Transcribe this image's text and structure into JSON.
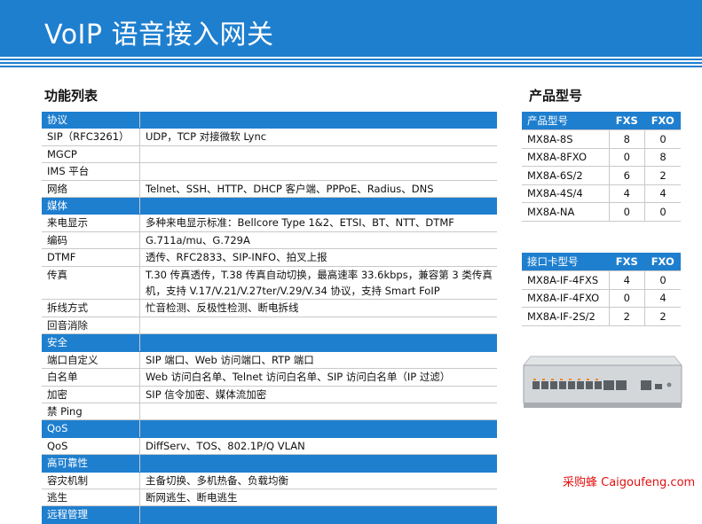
{
  "page_title": "VoIP 语音接入网关",
  "features_heading": "功能列表",
  "models_heading": "产品型号",
  "features": [
    {
      "type": "header",
      "label": "协议"
    },
    {
      "type": "row",
      "key": "SIP（RFC3261）",
      "value": "UDP，TCP 对接微软 Lync"
    },
    {
      "type": "row",
      "key": "MGCP",
      "value": ""
    },
    {
      "type": "row",
      "key": "IMS 平台",
      "value": ""
    },
    {
      "type": "row",
      "key": "网络",
      "value": "Telnet、SSH、HTTP、DHCP 客户端、PPPoE、Radius、DNS"
    },
    {
      "type": "header",
      "label": "媒体"
    },
    {
      "type": "row",
      "key": "来电显示",
      "value": "多种来电显示标准：Bellcore Type 1&2、ETSI、BT、NTT、DTMF"
    },
    {
      "type": "row",
      "key": "编码",
      "value": "G.711a/mu、G.729A"
    },
    {
      "type": "row",
      "key": "DTMF",
      "value": "透传、RFC2833、SIP-INFO、拍叉上报"
    },
    {
      "type": "tall",
      "key": "传真",
      "value": "T.30 传真透传，T.38 传真自动切换，最高速率 33.6kbps，兼容第 3 类传真机，支持 V.17/V.21/V.27ter/V.29/V.34 协议，支持 Smart FoIP"
    },
    {
      "type": "row",
      "key": "拆线方式",
      "value": "忙音检测、反极性检测、断电拆线"
    },
    {
      "type": "row",
      "key": "回音消除",
      "value": ""
    },
    {
      "type": "header",
      "label": "安全"
    },
    {
      "type": "row",
      "key": "端口自定义",
      "value": "SIP 端口、Web 访问端口、RTP 端口"
    },
    {
      "type": "row",
      "key": "白名单",
      "value": "Web 访问白名单、Telnet 访问白名单、SIP 访问白名单（IP 过滤）"
    },
    {
      "type": "row",
      "key": "加密",
      "value": "SIP 信令加密、媒体流加密"
    },
    {
      "type": "row",
      "key": "禁 Ping",
      "value": ""
    },
    {
      "type": "header",
      "label": "QoS"
    },
    {
      "type": "row",
      "key": "QoS",
      "value": "DiffServ、TOS、802.1P/Q VLAN"
    },
    {
      "type": "header",
      "label": "高可靠性"
    },
    {
      "type": "row",
      "key": "容灾机制",
      "value": "主备切换、多机热备、负载均衡"
    },
    {
      "type": "row",
      "key": "逃生",
      "value": "断网逃生、断电逃生"
    },
    {
      "type": "header",
      "label": "远程管理"
    }
  ],
  "models_table": {
    "headers": [
      "产品型号",
      "FXS",
      "FXO"
    ],
    "rows": [
      [
        "MX8A-8S",
        "8",
        "0"
      ],
      [
        "MX8A-8FXO",
        "0",
        "8"
      ],
      [
        "MX8A-6S/2",
        "6",
        "2"
      ],
      [
        "MX8A-4S/4",
        "4",
        "4"
      ],
      [
        "MX8A-NA",
        "0",
        "0"
      ]
    ]
  },
  "cards_table": {
    "headers": [
      "接口卡型号",
      "FXS",
      "FXO"
    ],
    "rows": [
      [
        "MX8A-IF-4FXS",
        "4",
        "0"
      ],
      [
        "MX8A-IF-4FXO",
        "0",
        "4"
      ],
      [
        "MX8A-IF-2S/2",
        "2",
        "2"
      ]
    ]
  },
  "footer_brand": "采购蜂 Caigoufeng.com",
  "colors": {
    "accent": "#1f7fcf",
    "brand_red": "#e21010"
  }
}
